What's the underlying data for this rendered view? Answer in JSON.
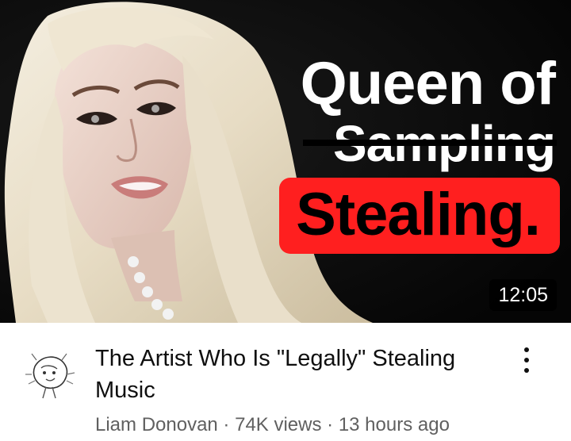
{
  "thumbnail": {
    "line1": "Queen of",
    "line2": "Sampling",
    "highlight": "Stealing.",
    "highlight_color": "#ff1f1f",
    "duration": "12:05"
  },
  "video": {
    "title": "The Artist Who Is \"Legally\" Stealing Music",
    "channel": "Liam Donovan",
    "views": "74K views",
    "age": "13 hours ago",
    "separator": " · "
  },
  "icons": {
    "more": "more-vert-icon",
    "avatar": "channel-avatar-sketch"
  }
}
